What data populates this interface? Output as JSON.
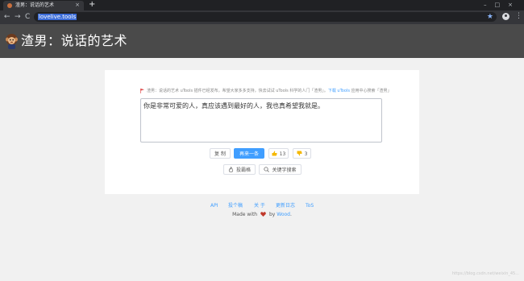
{
  "browser": {
    "tab_title": "渣男：说话的艺术",
    "tab_close": "×",
    "new_tab": "+",
    "window_controls": "–□×",
    "nav_back": "←",
    "nav_forward": "→",
    "nav_reload": "C",
    "url": "lovelive.tools",
    "bookmark_star": "★",
    "menu": "⋮"
  },
  "site": {
    "title": "渣男：说话的艺术"
  },
  "notice": {
    "text": "渣男：说话的艺术 uTools 插件已经发布，希望大家多多支持，快去试试 uTools 科学的人门「渣男」。",
    "link_text": "下载 uTools",
    "tail_text": " 应用中心搜索「渣男」"
  },
  "quote": {
    "text": "你是非常可爱的人，真应该遇到最好的人，我也真希望我就是。"
  },
  "actions": {
    "copy": "复 制",
    "next": "再来一条",
    "like_count": "13",
    "dislike_count": "3",
    "submit": "投霸格",
    "search": "关键字搜索"
  },
  "footer": {
    "links": [
      "API",
      "投个稿",
      "关 于",
      "更新日志",
      "ToS"
    ],
    "made_with_prefix": "Made with",
    "made_with_by": "by",
    "author": "Wood",
    "period": "."
  },
  "watermark": "https://blog.csdn.net/weixin_45..."
}
